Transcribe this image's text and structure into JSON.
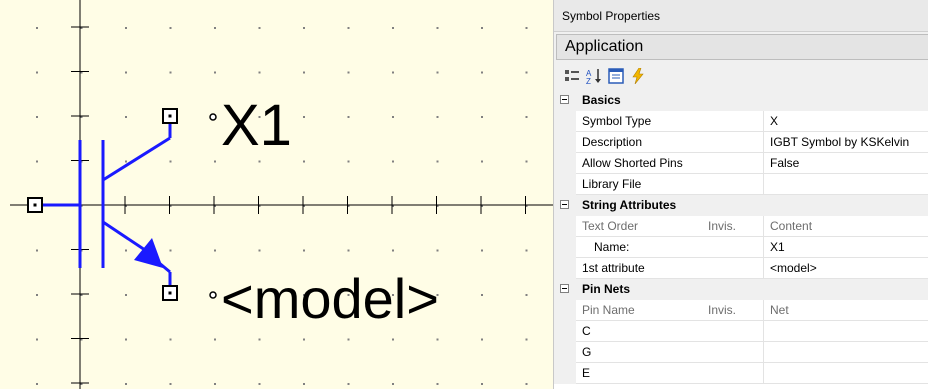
{
  "schematic": {
    "refdes": "X1",
    "model_placeholder": "<model>",
    "symbol_color": "#1a1aff",
    "grid_dot_color": "#808080",
    "wire_color": "#000000"
  },
  "panel": {
    "title": "Symbol Properties",
    "object": "Application",
    "toolbar": [
      {
        "icon": "categorized-icon"
      },
      {
        "icon": "sort-alphabetical-icon"
      },
      {
        "icon": "property-pages-icon"
      },
      {
        "icon": "events-lightning-icon"
      }
    ],
    "basics": {
      "label": "Basics",
      "rows": [
        {
          "name": "Symbol Type",
          "value": "X"
        },
        {
          "name": "Description",
          "value": "IGBT Symbol by KSKelvin"
        },
        {
          "name": "Allow Shorted Pins",
          "value": "False"
        },
        {
          "name": "Library File",
          "value": ""
        }
      ]
    },
    "string_attributes": {
      "label": "String Attributes",
      "header": {
        "col1": "Text Order",
        "col2": "Invis.",
        "col3": "Content"
      },
      "rows": [
        {
          "name": "Name:",
          "value": "X1"
        },
        {
          "name": "1st attribute",
          "value": "<model>"
        }
      ]
    },
    "pin_nets": {
      "label": "Pin Nets",
      "header": {
        "col1": "Pin Name",
        "col2": "Invis.",
        "col3": "Net"
      },
      "rows": [
        {
          "name": "C",
          "value": ""
        },
        {
          "name": "G",
          "value": ""
        },
        {
          "name": "E",
          "value": ""
        }
      ]
    }
  }
}
